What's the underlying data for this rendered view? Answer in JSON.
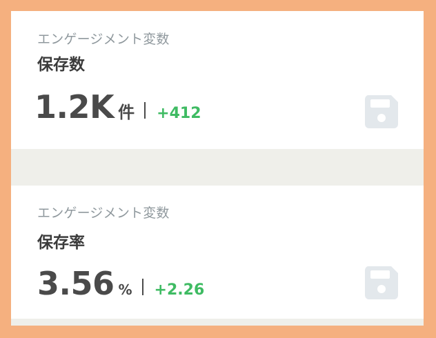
{
  "cards": [
    {
      "category": "エンゲージメント変数",
      "title": "保存数",
      "value": "1.2K",
      "unit": "件",
      "delta": "+412",
      "icon": "save-icon"
    },
    {
      "category": "エンゲージメント変数",
      "title": "保存率",
      "value": "3.56",
      "unit": "%",
      "delta": "+2.26",
      "icon": "save-icon"
    }
  ],
  "colors": {
    "outer_border": "#f5b07f",
    "card_background": "#ffffff",
    "separator_band": "#efefea",
    "category_text": "#8f989d",
    "value_text": "#4a4a4a",
    "delta_positive": "#3fbb63",
    "icon_fill": "#e3e8ec"
  }
}
